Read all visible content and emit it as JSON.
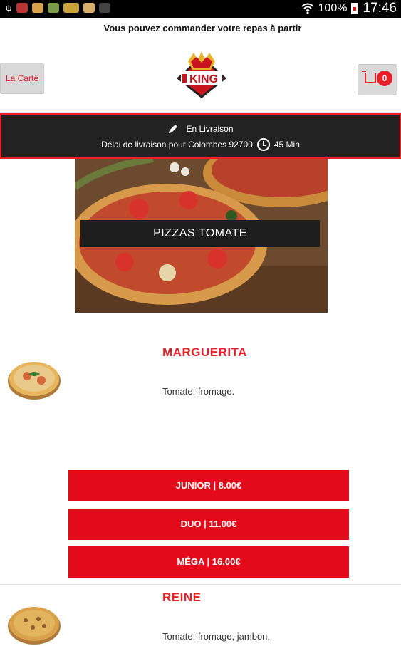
{
  "status_bar": {
    "battery": "100%",
    "time": "17:46",
    "icons": [
      "usb-icon",
      "notification-icons",
      "wifi-icon",
      "battery-icon"
    ]
  },
  "marquee": {
    "text": "Vous pouvez commander votre repas à partir"
  },
  "header": {
    "menu_button": "La Carte",
    "cart_count": "0",
    "logo_text": "KING"
  },
  "delivery": {
    "mode": "En Livraison",
    "delay_text": "Délai de livraison pour Colombes 92700",
    "duration": "45 Min"
  },
  "category": {
    "title": "PIZZAS TOMATE"
  },
  "products": [
    {
      "name": "MARGUERITA",
      "description": "Tomate, fromage.",
      "sizes": [
        "JUNIOR | 8.00€",
        "DUO | 11.00€",
        "MÉGA | 16.00€"
      ]
    },
    {
      "name": "REINE",
      "description": "Tomate, fromage, jambon,"
    }
  ],
  "colors": {
    "accent": "#e8202a",
    "button": "#e30b19",
    "banner": "#222222"
  }
}
